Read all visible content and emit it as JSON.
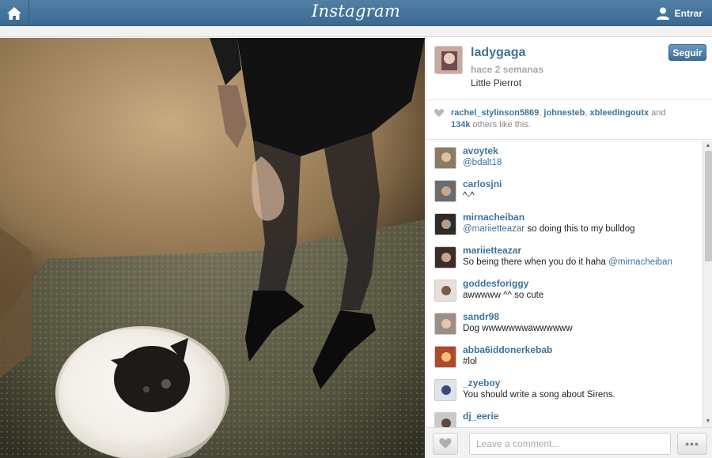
{
  "header": {
    "logo_text": "Instagram",
    "login_label": "Entrar",
    "icons": {
      "home": "home-icon",
      "user": "user-icon"
    }
  },
  "post": {
    "owner": {
      "username": "ladygaga",
      "time": "hace 2 semanas",
      "caption": "Little Pierrot"
    },
    "follow_label": "Seguir",
    "likes": {
      "users": [
        "rachel_stylinson5869",
        "johnesteb",
        "xbleedingoutx"
      ],
      "sep1": ", ",
      "sep2": ", ",
      "and_text": " and",
      "count": "134k",
      "tail": " others like this."
    }
  },
  "comments": [
    {
      "user": "avoytek",
      "text": "",
      "mention": "@bdalt18"
    },
    {
      "user": "carlosjni",
      "text": "^-^",
      "mention": ""
    },
    {
      "user": "mirnacheiban",
      "text": " so doing this to my bulldog",
      "mention": "@mariietteazar",
      "mention_first": true
    },
    {
      "user": "mariietteazar",
      "text": "So being there when you do it haha ",
      "mention": "@mirnacheiban"
    },
    {
      "user": "goddesforiggy",
      "text": "awwwww ^^ so cute",
      "mention": ""
    },
    {
      "user": "sandr98",
      "text": "Dog wwwwwwwawwwwww",
      "mention": ""
    },
    {
      "user": "abba6iddonerkebab",
      "text": "#lol",
      "mention": ""
    },
    {
      "user": "_zyeboy",
      "text": "You should write a song about Sirens.",
      "mention": ""
    },
    {
      "user": "dj_eerie",
      "text": "",
      "mention": ""
    }
  ],
  "footer": {
    "comment_placeholder": "Leave a comment...",
    "more_label": "•••"
  },
  "colors": {
    "topbar": "#3f729b",
    "link": "#3f729b",
    "muted": "#a5a7aa"
  }
}
